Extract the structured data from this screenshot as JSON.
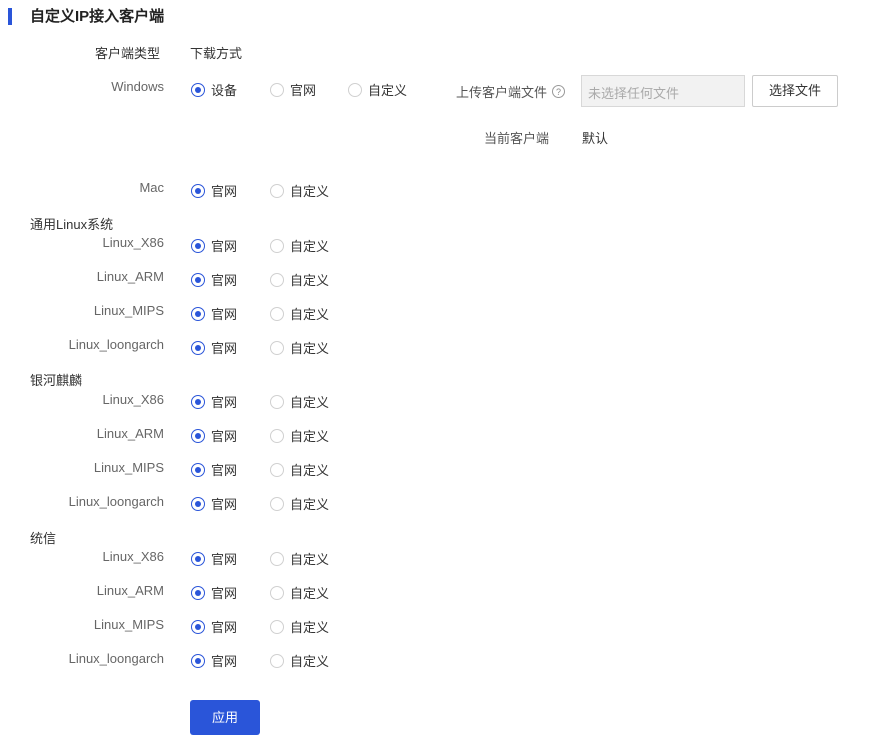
{
  "title": "自定义IP接入客户端",
  "header": {
    "label": "客户端类型",
    "value": "下载方式"
  },
  "windows": {
    "label": "Windows",
    "options": [
      "设备",
      "官网",
      "自定义"
    ],
    "selected": "设备",
    "upload_label": "上传客户端文件",
    "upload_help": "?",
    "file_placeholder": "未选择任何文件",
    "choose_button": "选择文件",
    "current_label": "当前客户端",
    "current_value": "默认"
  },
  "mac": {
    "label": "Mac",
    "options": [
      "官网",
      "自定义"
    ],
    "selected": "官网"
  },
  "groups": [
    {
      "name": "通用Linux系统",
      "rows": [
        {
          "label": "Linux_X86",
          "options": [
            "官网",
            "自定义"
          ],
          "selected": "官网"
        },
        {
          "label": "Linux_ARM",
          "options": [
            "官网",
            "自定义"
          ],
          "selected": "官网"
        },
        {
          "label": "Linux_MIPS",
          "options": [
            "官网",
            "自定义"
          ],
          "selected": "官网"
        },
        {
          "label": "Linux_loongarch",
          "options": [
            "官网",
            "自定义"
          ],
          "selected": "官网"
        }
      ]
    },
    {
      "name": "银河麒麟",
      "rows": [
        {
          "label": "Linux_X86",
          "options": [
            "官网",
            "自定义"
          ],
          "selected": "官网"
        },
        {
          "label": "Linux_ARM",
          "options": [
            "官网",
            "自定义"
          ],
          "selected": "官网"
        },
        {
          "label": "Linux_MIPS",
          "options": [
            "官网",
            "自定义"
          ],
          "selected": "官网"
        },
        {
          "label": "Linux_loongarch",
          "options": [
            "官网",
            "自定义"
          ],
          "selected": "官网"
        }
      ]
    },
    {
      "name": "统信",
      "rows": [
        {
          "label": "Linux_X86",
          "options": [
            "官网",
            "自定义"
          ],
          "selected": "官网"
        },
        {
          "label": "Linux_ARM",
          "options": [
            "官网",
            "自定义"
          ],
          "selected": "官网"
        },
        {
          "label": "Linux_MIPS",
          "options": [
            "官网",
            "自定义"
          ],
          "selected": "官网"
        },
        {
          "label": "Linux_loongarch",
          "options": [
            "官网",
            "自定义"
          ],
          "selected": "官网"
        }
      ]
    }
  ],
  "apply_button": "应用",
  "colors": {
    "accent": "#2a55d9"
  }
}
